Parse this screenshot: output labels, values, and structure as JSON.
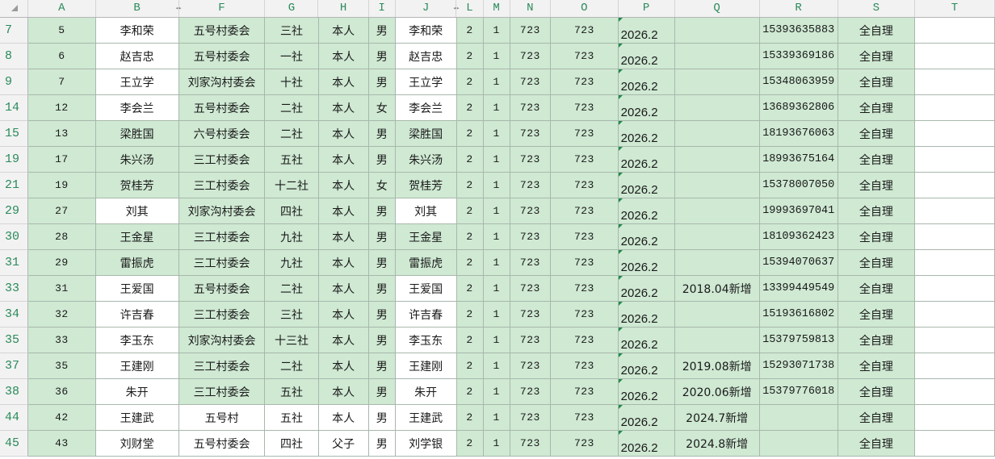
{
  "columns": [
    "A",
    "B",
    "F",
    "G",
    "H",
    "I",
    "J",
    "L",
    "M",
    "N",
    "O",
    "P",
    "Q",
    "R",
    "S",
    "T"
  ],
  "rows": [
    {
      "row": "7",
      "cells": [
        "5",
        "李和荣",
        "五号村委会",
        "三社",
        "本人",
        "男",
        "李和荣",
        "2",
        "1",
        "723",
        "723",
        "2026.2",
        "",
        "15393635883",
        "全自理",
        ""
      ]
    },
    {
      "row": "8",
      "cells": [
        "6",
        "赵吉忠",
        "五号村委会",
        "一社",
        "本人",
        "男",
        "赵吉忠",
        "2",
        "1",
        "723",
        "723",
        "2026.2",
        "",
        "15339369186",
        "全自理",
        ""
      ]
    },
    {
      "row": "9",
      "cells": [
        "7",
        "王立学",
        "刘家沟村委会",
        "十社",
        "本人",
        "男",
        "王立学",
        "2",
        "1",
        "723",
        "723",
        "2026.2",
        "",
        "15348063959",
        "全自理",
        ""
      ]
    },
    {
      "row": "14",
      "cells": [
        "12",
        "李会兰",
        "五号村委会",
        "二社",
        "本人",
        "女",
        "李会兰",
        "2",
        "1",
        "723",
        "723",
        "2026.2",
        "",
        "13689362806",
        "全自理",
        ""
      ]
    },
    {
      "row": "15",
      "cells": [
        "13",
        "梁胜国",
        "六号村委会",
        "二社",
        "本人",
        "男",
        "梁胜国",
        "2",
        "1",
        "723",
        "723",
        "2026.2",
        "",
        "18193676063",
        "全自理",
        ""
      ]
    },
    {
      "row": "19",
      "cells": [
        "17",
        "朱兴汤",
        "三工村委会",
        "五社",
        "本人",
        "男",
        "朱兴汤",
        "2",
        "1",
        "723",
        "723",
        "2026.2",
        "",
        "18993675164",
        "全自理",
        ""
      ]
    },
    {
      "row": "21",
      "cells": [
        "19",
        "贺桂芳",
        "三工村委会",
        "十二社",
        "本人",
        "女",
        "贺桂芳",
        "2",
        "1",
        "723",
        "723",
        "2026.2",
        "",
        "15378007050",
        "全自理",
        ""
      ]
    },
    {
      "row": "29",
      "cells": [
        "27",
        "刘其",
        "刘家沟村委会",
        "四社",
        "本人",
        "男",
        "刘其",
        "2",
        "1",
        "723",
        "723",
        "2026.2",
        "",
        "19993697041",
        "全自理",
        ""
      ]
    },
    {
      "row": "30",
      "cells": [
        "28",
        "王金星",
        "三工村委会",
        "九社",
        "本人",
        "男",
        "王金星",
        "2",
        "1",
        "723",
        "723",
        "2026.2",
        "",
        "18109362423",
        "全自理",
        ""
      ]
    },
    {
      "row": "31",
      "cells": [
        "29",
        "雷振虎",
        "三工村委会",
        "九社",
        "本人",
        "男",
        "雷振虎",
        "2",
        "1",
        "723",
        "723",
        "2026.2",
        "",
        "15394070637",
        "全自理",
        ""
      ]
    },
    {
      "row": "33",
      "cells": [
        "31",
        "王爱国",
        "五号村委会",
        "二社",
        "本人",
        "男",
        "王爱国",
        "2",
        "1",
        "723",
        "723",
        "2026.2",
        "2018.04新增",
        "13399449549",
        "全自理",
        ""
      ]
    },
    {
      "row": "34",
      "cells": [
        "32",
        "许吉春",
        "三工村委会",
        "三社",
        "本人",
        "男",
        "许吉春",
        "2",
        "1",
        "723",
        "723",
        "2026.2",
        "",
        "15193616802",
        "全自理",
        ""
      ]
    },
    {
      "row": "35",
      "cells": [
        "33",
        "李玉东",
        "刘家沟村委会",
        "十三社",
        "本人",
        "男",
        "李玉东",
        "2",
        "1",
        "723",
        "723",
        "2026.2",
        "",
        "15379759813",
        "全自理",
        ""
      ]
    },
    {
      "row": "37",
      "cells": [
        "35",
        "王建刚",
        "三工村委会",
        "二社",
        "本人",
        "男",
        "王建刚",
        "2",
        "1",
        "723",
        "723",
        "2026.2",
        "2019.08新增",
        "15293071738",
        "全自理",
        ""
      ]
    },
    {
      "row": "38",
      "cells": [
        "36",
        "朱开",
        "三工村委会",
        "五社",
        "本人",
        "男",
        "朱开",
        "2",
        "1",
        "723",
        "723",
        "2026.2",
        "2020.06新增",
        "15379776018",
        "全自理",
        ""
      ]
    },
    {
      "row": "44",
      "cells": [
        "42",
        "王建武",
        "五号村",
        "五社",
        "本人",
        "男",
        "王建武",
        "2",
        "1",
        "723",
        "723",
        "2026.2",
        "2024.7新增",
        "",
        "全自理",
        ""
      ]
    },
    {
      "row": "45",
      "cells": [
        "43",
        "刘财堂",
        "五号村委会",
        "四社",
        "父子",
        "男",
        "刘学银",
        "2",
        "1",
        "723",
        "723",
        "2026.2",
        "2024.8新增",
        "",
        "全自理",
        ""
      ]
    }
  ],
  "colors": {
    "highlight": "#cfe9d3",
    "header_text": "#2a8a5b",
    "header_bg": "#f2f2f2"
  }
}
